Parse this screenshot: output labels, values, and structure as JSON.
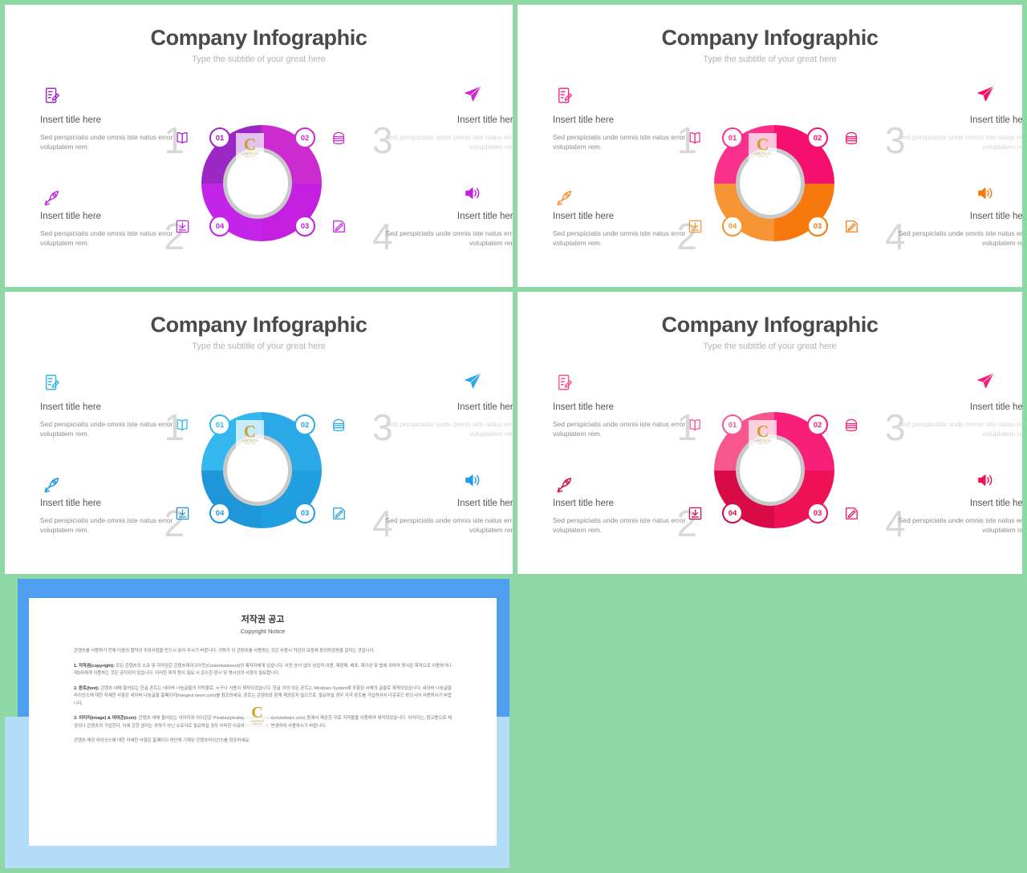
{
  "canvas": {
    "background": "#8ed8a6"
  },
  "slide_common": {
    "title": "Company Infographic",
    "subtitle": "Type the subtitle of your great here",
    "items": [
      {
        "number": "1",
        "title": "Insert title here",
        "desc": "Sed perspiciatis unde omnis iste natus error voluptatem rem.",
        "corner_icon": "note-edit-icon",
        "side_icon": "open-book-icon",
        "badge": "01"
      },
      {
        "number": "2",
        "title": "Insert title here",
        "desc": "Sed perspiciatis unde omnis iste natus error voluptatem rem.",
        "corner_icon": "rocket-icon",
        "side_icon": "download-box-icon",
        "badge": "04"
      },
      {
        "number": "3",
        "title": "Insert title here",
        "desc": "Sed perspiciatis unde omnis iste natus error voluptatem rem.",
        "corner_icon": "paper-plane-icon",
        "side_icon": "layers-stack-icon",
        "badge": "02"
      },
      {
        "number": "4",
        "title": "Insert title here",
        "desc": "Sed perspiciatis unde omnis iste natus error voluptatem rem.",
        "corner_icon": "speaker-volume-icon",
        "side_icon": "pencil-edit-icon",
        "badge": "03"
      }
    ],
    "logo": {
      "letter": "C",
      "line1": "CONTENTS",
      "line2": "TAKE  OUT"
    }
  },
  "slides": [
    {
      "id": "slide-purple",
      "theme": {
        "q_tl": "#9b27c4",
        "q_tr": "#cc2bd0",
        "q_bl": "#c423e8",
        "q_br": "#c41fe0",
        "icon1": "#a328c9",
        "icon2": "#c22be0",
        "icon3": "#cc2bd0",
        "icon4": "#c41fe0",
        "badge1": "#9b27c4",
        "badge2": "#cc2bd0",
        "badge3": "#c41fe0",
        "badge4": "#c423e8"
      }
    },
    {
      "id": "slide-pink-orange",
      "theme": {
        "q_tl": "#f9318c",
        "q_tr": "#f50f6e",
        "q_bl": "#f79433",
        "q_br": "#f7790d",
        "icon1": "#f9318c",
        "icon2": "#f79433",
        "icon3": "#f50f6e",
        "icon4": "#f7790d",
        "badge1": "#f9318c",
        "badge2": "#f50f6e",
        "badge3": "#f7790d",
        "badge4": "#f79433"
      }
    },
    {
      "id": "slide-blue",
      "theme": {
        "q_tl": "#34b7ef",
        "q_tr": "#2ba9e6",
        "q_bl": "#1f96d8",
        "q_br": "#1f9fdf",
        "icon1": "#34b7ef",
        "icon2": "#1f96d8",
        "icon3": "#2ba9e6",
        "icon4": "#1f9fdf",
        "badge1": "#34b7ef",
        "badge2": "#2ba9e6",
        "badge3": "#1f9fdf",
        "badge4": "#1f96d8"
      }
    },
    {
      "id": "slide-crimson-pink",
      "theme": {
        "q_tl": "#f7578c",
        "q_tr": "#f71f78",
        "q_bl": "#d80b47",
        "q_br": "#ef1155",
        "icon1": "#f7578c",
        "icon2": "#d80b47",
        "icon3": "#f71f78",
        "icon4": "#ef1155",
        "badge1": "#f7578c",
        "badge2": "#f71f78",
        "badge3": "#ef1155",
        "badge4": "#d80b47"
      }
    }
  ],
  "copyright_slide": {
    "title_ko": "저작권 공고",
    "title_en": "Copyright Notice",
    "paragraphs": [
      {
        "lead": "",
        "text": "콘텐츠를 사용하기 전에 다음의 협약과 주의사항을 반드시 읽어 주시기 바랍니다. 귀하가 이 콘텐츠를 사용하는 것은 사용시 약관의 보증에 동의하셨음을 알리는 것입니다."
      },
      {
        "lead": "1. 저작권(copyright):",
        "text": " 모든 콘텐츠의 소유 및 저작권은 콘텐츠테이크아웃(Contentstakeout)의 제작자에게 있습니다. 사전 승낙 없이 상업적 이용, 재판매, 배포, 재가공 및 법에 의하여 명시된 목적으로 이용하거나 제3자에게 이용하는 것은 금지되어 있습니다. 이러한 목적 등이 필요 시 준수한 판시 및 명시상의 사항이 필요합니다."
      },
      {
        "lead": "2. 폰트(font):",
        "text": " 콘텐츠 내에 들어있는 한글 폰트는 네이버 나눔글꼴의 저작물로, 누구나 사용이 제작되었습니다. 한글 외의 모든 폰트는 Windows System에 포함된 서체의 글꼴로 제작되었습니다. 네이버 나눔글꼴 라이선스에 대한 자세한 사항은 네이버 나눔글꼴 홈페이지(hangeul.naver.com)를 참조하세요. 폰트는 콘텐츠와 함께 제공되지 않으므로, 필요하실 경우 각각 폰트를 가입하셔서 다운로드 받으시어 사용하시기 바랍니다."
      },
      {
        "lead": "3. 이미지(image) & 아이콘(icon):",
        "text": " 콘텐츠 내에 들어있는 이미지와 아이콘은 Pixabay(pixabay.com)와 Webalys(webalys.com) 등에서 제공한 무료 저작물을 이용하여 제작되었습니다. 이미지는, 참고용으로 제공되나 콘텐츠의 구입한다. 이에 관한 권리는 귀하가 아닌 소유자로 필요하실 경우 어떠한 이유에서나 이미지를 변경하여 사용하시기 바랍니다."
      },
      {
        "lead": "",
        "text": "콘텐츠 제공 라이선스에 대한 자세한 사항은 홈페이지 하단에 기재된 콘텐츠라이선스를 참조하세요."
      }
    ],
    "logo": {
      "letter": "C",
      "line1": "CONTENTS",
      "line2": "TAKE  OUT"
    }
  }
}
